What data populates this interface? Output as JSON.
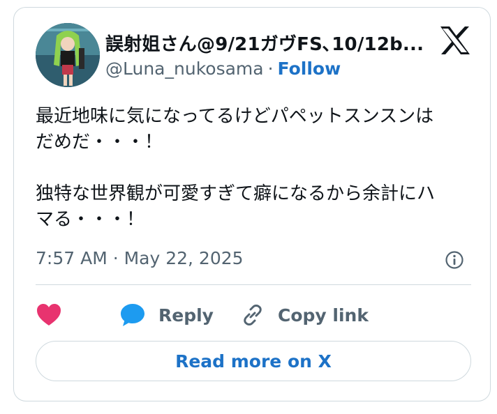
{
  "author": {
    "display_name": "誤射姐さん@9/21ガヴFS､10/12b...",
    "handle": "@Luna_nukosama",
    "separator": "·",
    "follow_label": "Follow"
  },
  "tweet": {
    "text": "最近地味に気になってるけどパペットスンスンは\nだめだ・・・！\n\n独特な世界観が可愛すぎて癖になるから余計にハ\nマる・・・！",
    "timestamp": "7:57 AM · May 22, 2025"
  },
  "actions": {
    "like_icon": "heart-icon",
    "reply_label": "Reply",
    "reply_icon": "speech-bubble-icon",
    "copy_label": "Copy link",
    "copy_icon": "link-icon"
  },
  "read_more_label": "Read more on X",
  "colors": {
    "accent": "#1d72c7",
    "heart": "#e8336f",
    "reply_bubble": "#1d9bf0",
    "muted": "#536471",
    "border": "#cfd9de"
  },
  "icons": {
    "brand": "x-logo-icon",
    "info": "info-icon"
  }
}
